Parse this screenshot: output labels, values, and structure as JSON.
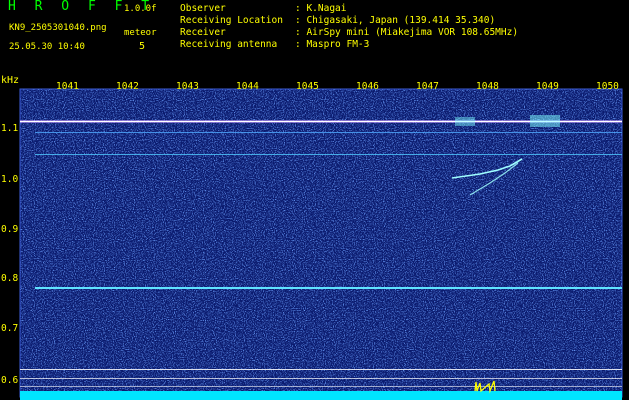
{
  "header": {
    "title": "H R O F F T",
    "version": "1.0.0f",
    "filename": "KN9_2505301040.png",
    "datetime": "25.05.30 10:40",
    "mode_label": "meteor",
    "mode_value": "5"
  },
  "info": [
    {
      "key": "Observer",
      "value": ": K.Nagai"
    },
    {
      "key": "Receiving Location",
      "value": ": Chigasaki, Japan (139.414 35.340)"
    },
    {
      "key": "Receiver",
      "value": ": AirSpy mini (Miakejima VOR 108.65MHz)"
    },
    {
      "key": "Receiving antenna",
      "value": ": Maspro FM-3"
    }
  ],
  "spectrogram": {
    "y_unit": "kHz",
    "x_ticks": [
      "1041",
      "1042",
      "1043",
      "1044",
      "1045",
      "1046",
      "1047",
      "1048",
      "1049",
      "1050"
    ],
    "y_ticks": [
      "1.1",
      "1.0",
      "0.9",
      "0.8",
      "0.7",
      "0.6"
    ],
    "colors": {
      "background": "#0a1a6e",
      "noise": "#2a5cff",
      "carrier": "#ffffff",
      "trace": "#7fffff",
      "baseline": "#00e5ff",
      "labels": "#ffff00",
      "title": "#00ff00"
    }
  }
}
